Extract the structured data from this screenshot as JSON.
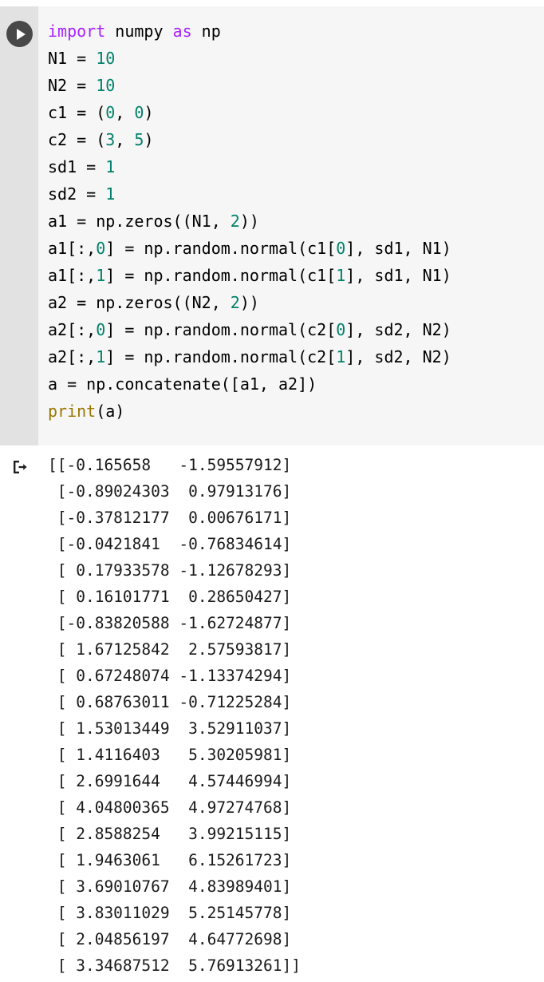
{
  "notebook": {
    "cell": {
      "run_button_title": "Run cell",
      "run_icon": "play-icon",
      "output_icon": "output-arrow-icon",
      "colors": {
        "keyword": "#aa22ff",
        "number": "#00816a",
        "function": "#997700",
        "plain": "#000000",
        "gutter_bg": "#e2e2e2",
        "code_bg": "#f6f6f6",
        "output_bg": "#ffffff"
      },
      "code_lines": [
        [
          {
            "t": "import",
            "c": "kw"
          },
          {
            "t": " numpy ",
            "c": "pl"
          },
          {
            "t": "as",
            "c": "kw"
          },
          {
            "t": " np",
            "c": "pl"
          }
        ],
        [
          {
            "t": "N1 = ",
            "c": "pl"
          },
          {
            "t": "10",
            "c": "num"
          }
        ],
        [
          {
            "t": "N2 = ",
            "c": "pl"
          },
          {
            "t": "10",
            "c": "num"
          }
        ],
        [
          {
            "t": "c1 = (",
            "c": "pl"
          },
          {
            "t": "0",
            "c": "num"
          },
          {
            "t": ", ",
            "c": "pl"
          },
          {
            "t": "0",
            "c": "num"
          },
          {
            "t": ")",
            "c": "pl"
          }
        ],
        [
          {
            "t": "c2 = (",
            "c": "pl"
          },
          {
            "t": "3",
            "c": "num"
          },
          {
            "t": ", ",
            "c": "pl"
          },
          {
            "t": "5",
            "c": "num"
          },
          {
            "t": ")",
            "c": "pl"
          }
        ],
        [
          {
            "t": "sd1 = ",
            "c": "pl"
          },
          {
            "t": "1",
            "c": "num"
          }
        ],
        [
          {
            "t": "sd2 = ",
            "c": "pl"
          },
          {
            "t": "1",
            "c": "num"
          }
        ],
        [
          {
            "t": "a1 = np.zeros((N1, ",
            "c": "pl"
          },
          {
            "t": "2",
            "c": "num"
          },
          {
            "t": "))",
            "c": "pl"
          }
        ],
        [
          {
            "t": "a1[:,",
            "c": "pl"
          },
          {
            "t": "0",
            "c": "num"
          },
          {
            "t": "] = np.random.normal(c1[",
            "c": "pl"
          },
          {
            "t": "0",
            "c": "num"
          },
          {
            "t": "], sd1, N1)",
            "c": "pl"
          }
        ],
        [
          {
            "t": "a1[:,",
            "c": "pl"
          },
          {
            "t": "1",
            "c": "num"
          },
          {
            "t": "] = np.random.normal(c1[",
            "c": "pl"
          },
          {
            "t": "1",
            "c": "num"
          },
          {
            "t": "], sd1, N1)",
            "c": "pl"
          }
        ],
        [
          {
            "t": "a2 = np.zeros((N2, ",
            "c": "pl"
          },
          {
            "t": "2",
            "c": "num"
          },
          {
            "t": "))",
            "c": "pl"
          }
        ],
        [
          {
            "t": "a2[:,",
            "c": "pl"
          },
          {
            "t": "0",
            "c": "num"
          },
          {
            "t": "] = np.random.normal(c2[",
            "c": "pl"
          },
          {
            "t": "0",
            "c": "num"
          },
          {
            "t": "], sd2, N2)",
            "c": "pl"
          }
        ],
        [
          {
            "t": "a2[:,",
            "c": "pl"
          },
          {
            "t": "1",
            "c": "num"
          },
          {
            "t": "] = np.random.normal(c2[",
            "c": "pl"
          },
          {
            "t": "1",
            "c": "num"
          },
          {
            "t": "], sd2, N2)",
            "c": "pl"
          }
        ],
        [
          {
            "t": "a = np.concatenate([a1, a2])",
            "c": "pl"
          }
        ],
        [
          {
            "t": "print",
            "c": "fn"
          },
          {
            "t": "(a)",
            "c": "pl"
          }
        ]
      ],
      "output_lines": [
        "[[-0.165658   -1.59557912]",
        " [-0.89024303  0.97913176]",
        " [-0.37812177  0.00676171]",
        " [-0.0421841  -0.76834614]",
        " [ 0.17933578 -1.12678293]",
        " [ 0.16101771  0.28650427]",
        " [-0.83820588 -1.62724877]",
        " [ 1.67125842  2.57593817]",
        " [ 0.67248074 -1.13374294]",
        " [ 0.68763011 -0.71225284]",
        " [ 1.53013449  3.52911037]",
        " [ 1.4116403   5.30205981]",
        " [ 2.6991644   4.57446994]",
        " [ 4.04800365  4.97274768]",
        " [ 2.8588254   3.99215115]",
        " [ 1.9463061   6.15261723]",
        " [ 3.69010767  4.83989401]",
        " [ 3.83011029  5.25145778]",
        " [ 2.04856197  4.64772698]",
        " [ 3.34687512  5.76913261]]"
      ]
    }
  }
}
